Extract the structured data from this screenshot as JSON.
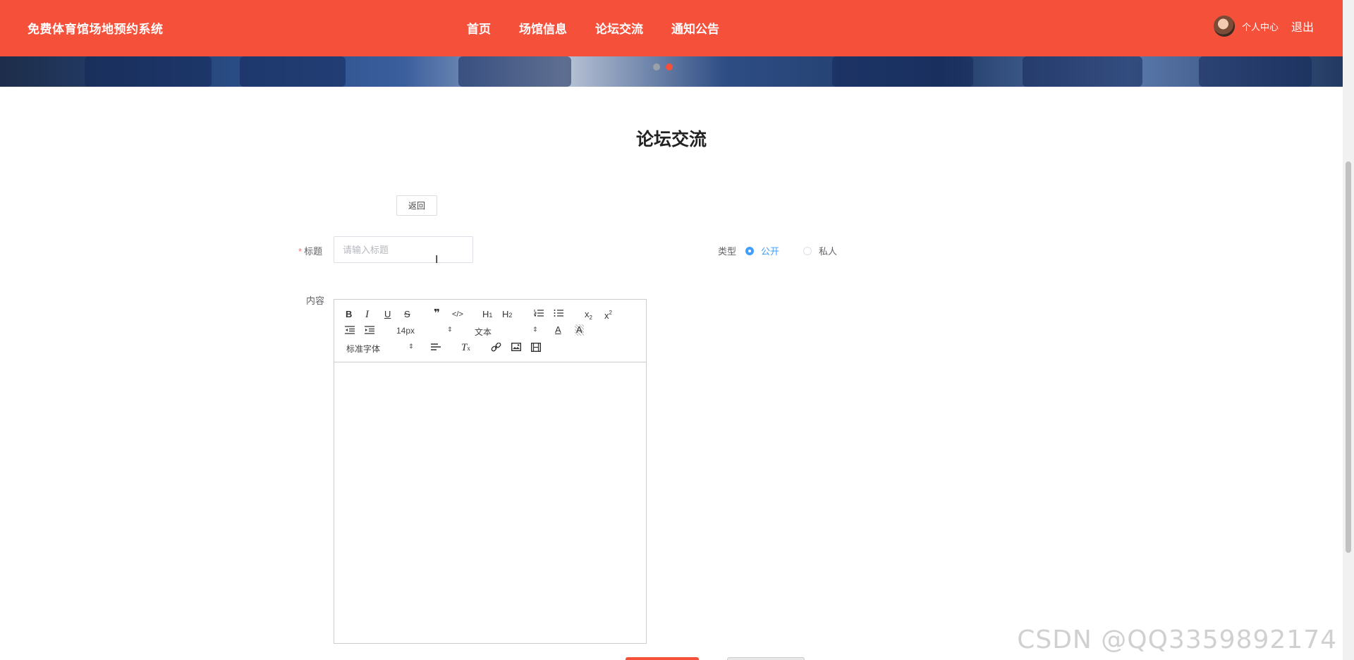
{
  "header": {
    "logo": "免费体育馆场地预约系统",
    "nav": [
      "首页",
      "场馆信息",
      "论坛交流",
      "通知公告"
    ],
    "user_center": "个人中心",
    "logout": "退出"
  },
  "page": {
    "title": "论坛交流",
    "back_label": "返回"
  },
  "form": {
    "title_label": "标题",
    "title_required_mark": "*",
    "title_placeholder": "请输入标题",
    "title_value": "",
    "type_label": "类型",
    "type_options": [
      "公开",
      "私人"
    ],
    "type_selected": "公开",
    "content_label": "内容"
  },
  "editor": {
    "font_size": "14px",
    "header_select": "文本",
    "font_family": "标准字体"
  },
  "watermark": "CSDN @QQ3359892174",
  "colors": {
    "brand": "#f5503a",
    "accent": "#409eff"
  }
}
